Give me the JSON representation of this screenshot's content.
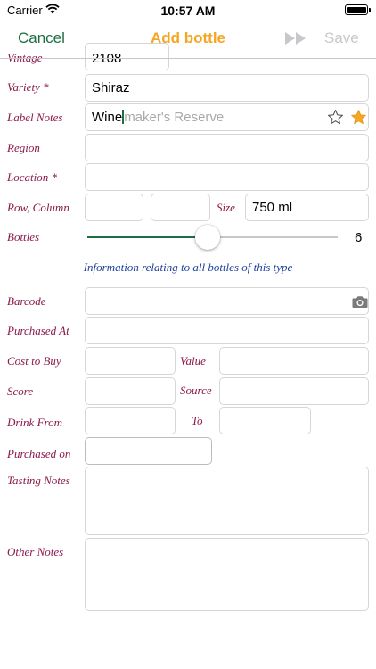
{
  "status_bar": {
    "carrier": "Carrier",
    "time": "10:57 AM",
    "icons": [
      "wifi-icon",
      "battery-icon"
    ]
  },
  "nav": {
    "cancel": "Cancel",
    "title": "Add bottle",
    "save": "Save",
    "icons": [
      "fast-forward-icon"
    ]
  },
  "form": {
    "vintage": {
      "label": "Vintage",
      "value": "2108"
    },
    "variety": {
      "label": "Variety *",
      "value": "Shiraz"
    },
    "label_notes": {
      "label": "Label Notes",
      "value": "Wine",
      "suggestion": "maker's Reserve",
      "icons": [
        "star-outline-icon",
        "star-filled-icon"
      ]
    },
    "region": {
      "label": "Region",
      "value": ""
    },
    "location": {
      "label": "Location *",
      "value": ""
    },
    "row_column": {
      "label": "Row, Column",
      "row": "",
      "column": ""
    },
    "size": {
      "label": "Size",
      "value": "750 ml"
    },
    "bottles": {
      "label": "Bottles",
      "value": 6,
      "slider_fraction": 0.48
    },
    "info": "Information relating to all bottles of this type",
    "barcode": {
      "label": "Barcode",
      "value": "",
      "icons": [
        "camera-icon"
      ]
    },
    "purchased_at": {
      "label": "Purchased At",
      "value": ""
    },
    "cost_to_buy": {
      "label": "Cost to Buy",
      "value": ""
    },
    "value": {
      "label": "Value",
      "value": ""
    },
    "score": {
      "label": "Score",
      "value": ""
    },
    "source": {
      "label": "Source",
      "value": ""
    },
    "drink_from": {
      "label": "Drink From",
      "value": ""
    },
    "to": {
      "label": "To",
      "value": ""
    },
    "purchased_on": {
      "label": "Purchased on",
      "value": ""
    },
    "tasting_notes": {
      "label": "Tasting Notes",
      "value": ""
    },
    "other_notes": {
      "label": "Other Notes",
      "value": ""
    }
  },
  "colors": {
    "accent_green": "#1f6e43",
    "title_orange": "#f5a623",
    "label_maroon": "#8b1a4a",
    "info_blue": "#1c3f9e",
    "disabled_gray": "#c7c7cc"
  }
}
